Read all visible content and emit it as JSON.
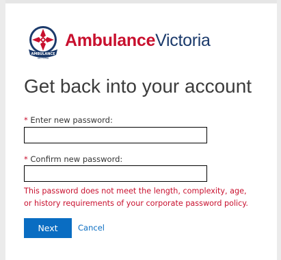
{
  "brand": {
    "name_part1": "Ambulance",
    "name_part2": "Victoria",
    "logo_text": "AMBULANCE",
    "logo_subtext": "VICTORIA",
    "logo_icon": "ambulance-victoria-crest",
    "primary_color": "#c8102e",
    "secondary_color": "#1b3a6b"
  },
  "page": {
    "title": "Get back into your account"
  },
  "form": {
    "required_marker": "*",
    "new_password_label": "Enter new password:",
    "new_password_value": "",
    "confirm_password_label": "Confirm new password:",
    "confirm_password_value": "",
    "error_message": "This password does not meet the length, complexity, age, or history requirements of your corporate password policy.",
    "error_color": "#c8102e"
  },
  "actions": {
    "next_label": "Next",
    "cancel_label": "Cancel",
    "accent_color": "#0a6dc2"
  }
}
